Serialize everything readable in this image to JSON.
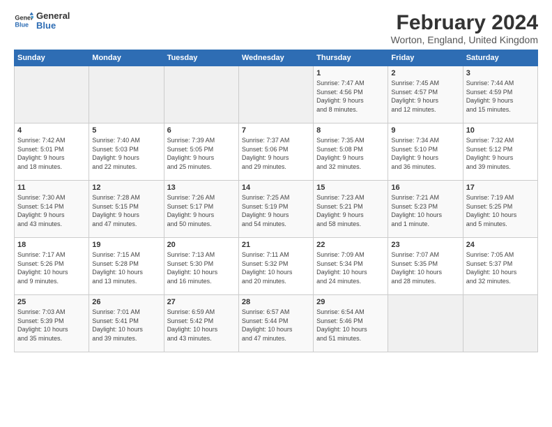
{
  "logo": {
    "line1": "General",
    "line2": "Blue"
  },
  "title": "February 2024",
  "location": "Worton, England, United Kingdom",
  "headers": [
    "Sunday",
    "Monday",
    "Tuesday",
    "Wednesday",
    "Thursday",
    "Friday",
    "Saturday"
  ],
  "weeks": [
    [
      {
        "day": "",
        "info": ""
      },
      {
        "day": "",
        "info": ""
      },
      {
        "day": "",
        "info": ""
      },
      {
        "day": "",
        "info": ""
      },
      {
        "day": "1",
        "info": "Sunrise: 7:47 AM\nSunset: 4:56 PM\nDaylight: 9 hours\nand 8 minutes."
      },
      {
        "day": "2",
        "info": "Sunrise: 7:45 AM\nSunset: 4:57 PM\nDaylight: 9 hours\nand 12 minutes."
      },
      {
        "day": "3",
        "info": "Sunrise: 7:44 AM\nSunset: 4:59 PM\nDaylight: 9 hours\nand 15 minutes."
      }
    ],
    [
      {
        "day": "4",
        "info": "Sunrise: 7:42 AM\nSunset: 5:01 PM\nDaylight: 9 hours\nand 18 minutes."
      },
      {
        "day": "5",
        "info": "Sunrise: 7:40 AM\nSunset: 5:03 PM\nDaylight: 9 hours\nand 22 minutes."
      },
      {
        "day": "6",
        "info": "Sunrise: 7:39 AM\nSunset: 5:05 PM\nDaylight: 9 hours\nand 25 minutes."
      },
      {
        "day": "7",
        "info": "Sunrise: 7:37 AM\nSunset: 5:06 PM\nDaylight: 9 hours\nand 29 minutes."
      },
      {
        "day": "8",
        "info": "Sunrise: 7:35 AM\nSunset: 5:08 PM\nDaylight: 9 hours\nand 32 minutes."
      },
      {
        "day": "9",
        "info": "Sunrise: 7:34 AM\nSunset: 5:10 PM\nDaylight: 9 hours\nand 36 minutes."
      },
      {
        "day": "10",
        "info": "Sunrise: 7:32 AM\nSunset: 5:12 PM\nDaylight: 9 hours\nand 39 minutes."
      }
    ],
    [
      {
        "day": "11",
        "info": "Sunrise: 7:30 AM\nSunset: 5:14 PM\nDaylight: 9 hours\nand 43 minutes."
      },
      {
        "day": "12",
        "info": "Sunrise: 7:28 AM\nSunset: 5:15 PM\nDaylight: 9 hours\nand 47 minutes."
      },
      {
        "day": "13",
        "info": "Sunrise: 7:26 AM\nSunset: 5:17 PM\nDaylight: 9 hours\nand 50 minutes."
      },
      {
        "day": "14",
        "info": "Sunrise: 7:25 AM\nSunset: 5:19 PM\nDaylight: 9 hours\nand 54 minutes."
      },
      {
        "day": "15",
        "info": "Sunrise: 7:23 AM\nSunset: 5:21 PM\nDaylight: 9 hours\nand 58 minutes."
      },
      {
        "day": "16",
        "info": "Sunrise: 7:21 AM\nSunset: 5:23 PM\nDaylight: 10 hours\nand 1 minute."
      },
      {
        "day": "17",
        "info": "Sunrise: 7:19 AM\nSunset: 5:25 PM\nDaylight: 10 hours\nand 5 minutes."
      }
    ],
    [
      {
        "day": "18",
        "info": "Sunrise: 7:17 AM\nSunset: 5:26 PM\nDaylight: 10 hours\nand 9 minutes."
      },
      {
        "day": "19",
        "info": "Sunrise: 7:15 AM\nSunset: 5:28 PM\nDaylight: 10 hours\nand 13 minutes."
      },
      {
        "day": "20",
        "info": "Sunrise: 7:13 AM\nSunset: 5:30 PM\nDaylight: 10 hours\nand 16 minutes."
      },
      {
        "day": "21",
        "info": "Sunrise: 7:11 AM\nSunset: 5:32 PM\nDaylight: 10 hours\nand 20 minutes."
      },
      {
        "day": "22",
        "info": "Sunrise: 7:09 AM\nSunset: 5:34 PM\nDaylight: 10 hours\nand 24 minutes."
      },
      {
        "day": "23",
        "info": "Sunrise: 7:07 AM\nSunset: 5:35 PM\nDaylight: 10 hours\nand 28 minutes."
      },
      {
        "day": "24",
        "info": "Sunrise: 7:05 AM\nSunset: 5:37 PM\nDaylight: 10 hours\nand 32 minutes."
      }
    ],
    [
      {
        "day": "25",
        "info": "Sunrise: 7:03 AM\nSunset: 5:39 PM\nDaylight: 10 hours\nand 35 minutes."
      },
      {
        "day": "26",
        "info": "Sunrise: 7:01 AM\nSunset: 5:41 PM\nDaylight: 10 hours\nand 39 minutes."
      },
      {
        "day": "27",
        "info": "Sunrise: 6:59 AM\nSunset: 5:42 PM\nDaylight: 10 hours\nand 43 minutes."
      },
      {
        "day": "28",
        "info": "Sunrise: 6:57 AM\nSunset: 5:44 PM\nDaylight: 10 hours\nand 47 minutes."
      },
      {
        "day": "29",
        "info": "Sunrise: 6:54 AM\nSunset: 5:46 PM\nDaylight: 10 hours\nand 51 minutes."
      },
      {
        "day": "",
        "info": ""
      },
      {
        "day": "",
        "info": ""
      }
    ]
  ]
}
